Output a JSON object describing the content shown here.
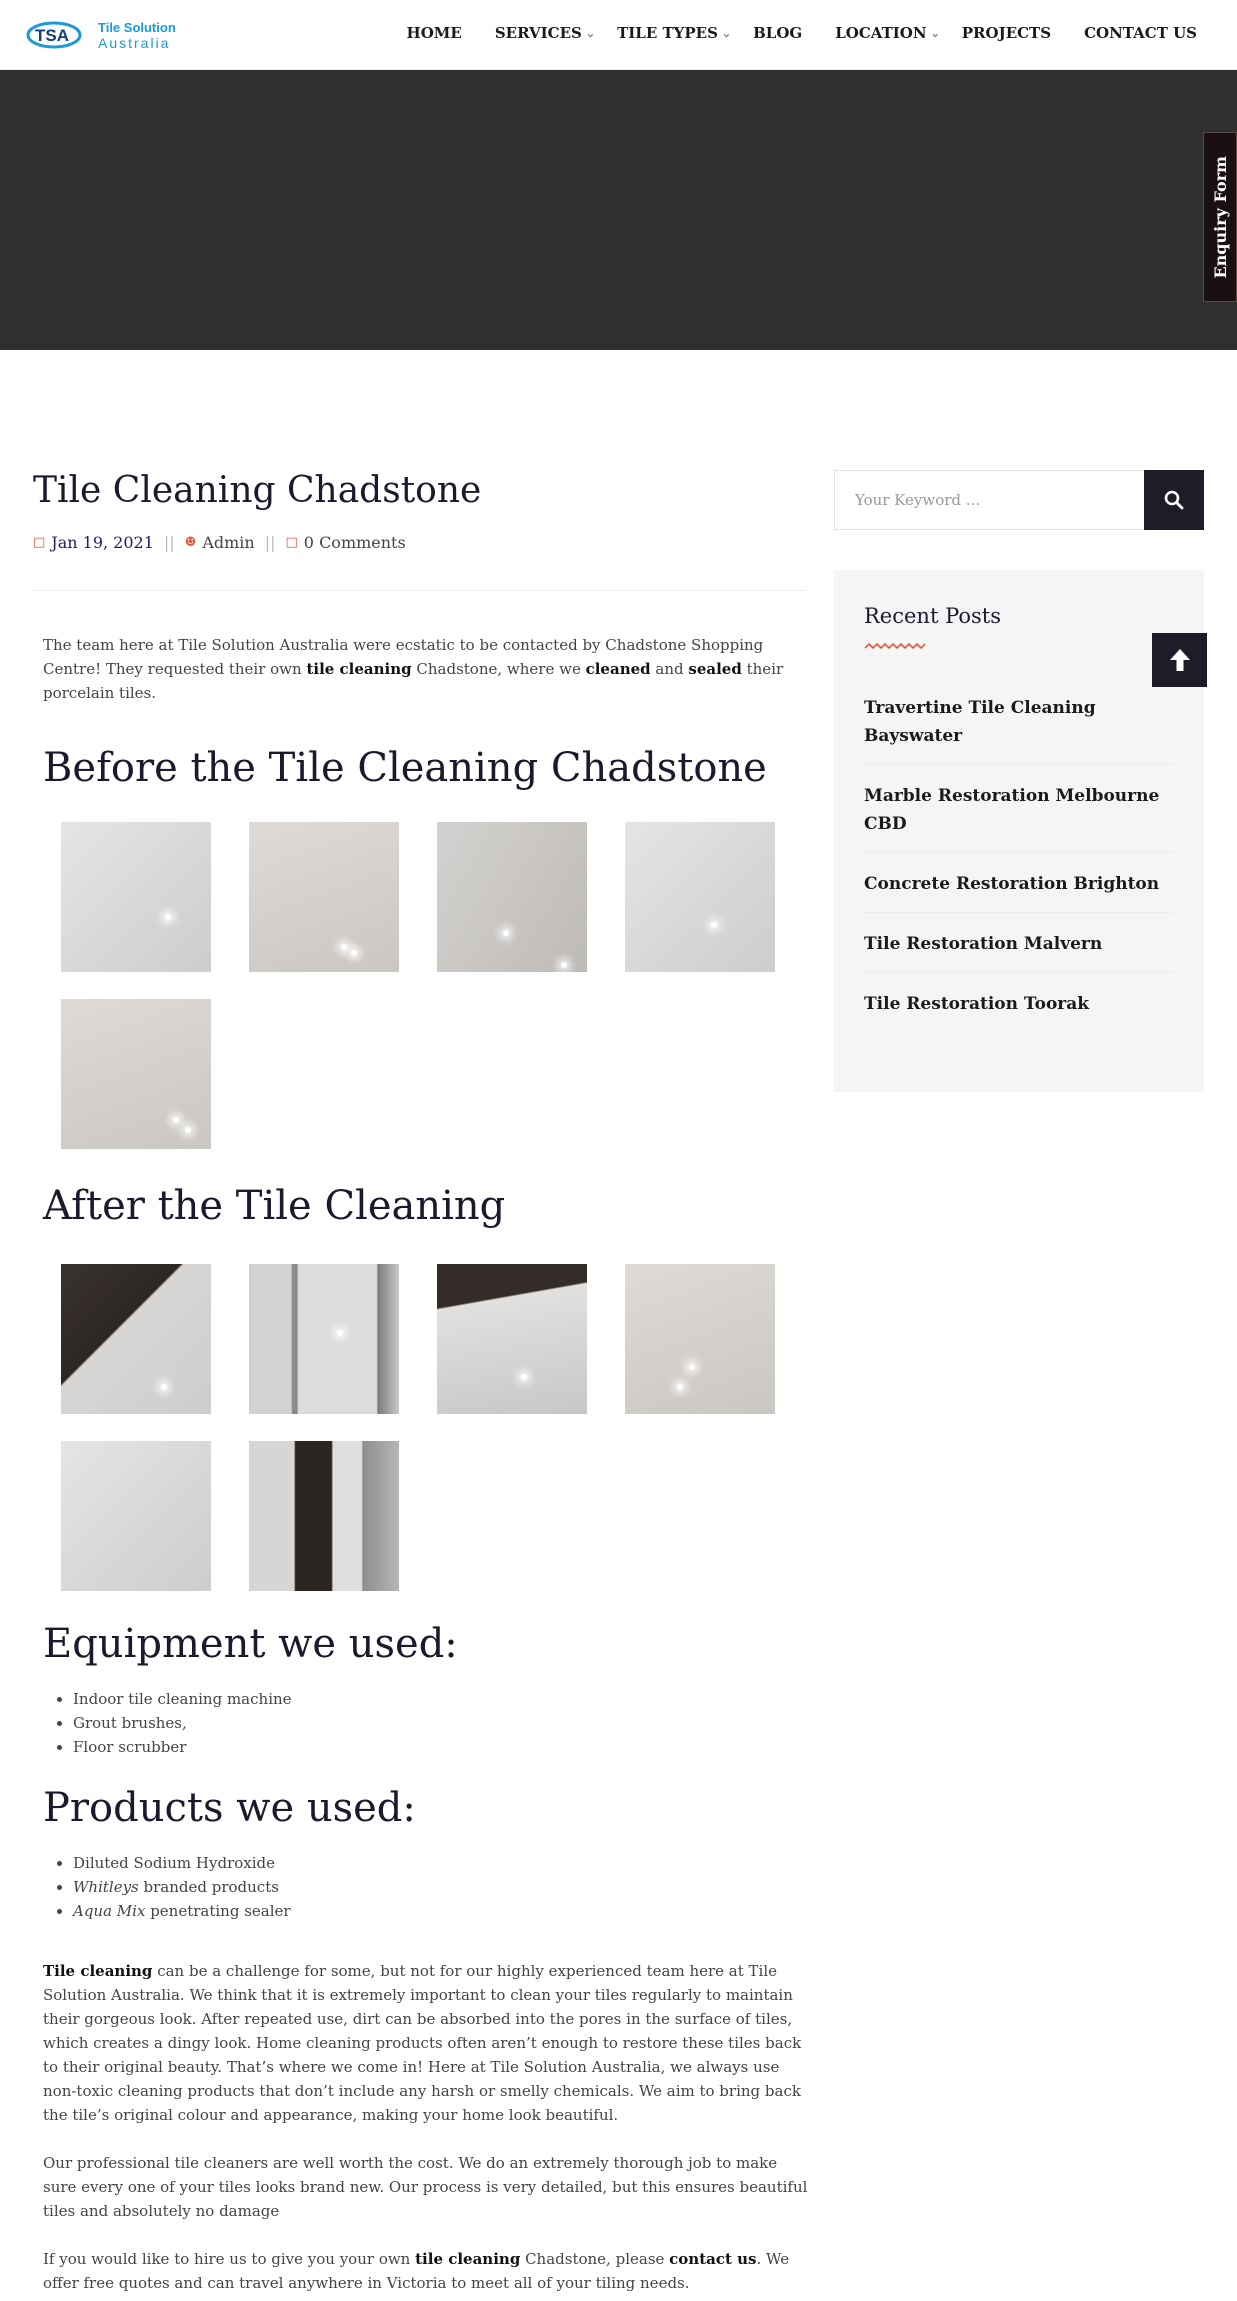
{
  "header": {
    "logo_text_top": "Tile Solution",
    "logo_text_bottom": "Australia",
    "logo_mark": "TSA",
    "nav": [
      {
        "label": "HOME",
        "dropdown": false
      },
      {
        "label": "SERVICES",
        "dropdown": true
      },
      {
        "label": "TILE TYPES",
        "dropdown": true
      },
      {
        "label": "BLOG",
        "dropdown": false
      },
      {
        "label": "LOCATION",
        "dropdown": true
      },
      {
        "label": "PROJECTS",
        "dropdown": false
      },
      {
        "label": "CONTACT US",
        "dropdown": false
      }
    ]
  },
  "enquiry_tab": "Enquiry Form",
  "post": {
    "title": "Tile Cleaning Chadstone",
    "date": "Jan 19, 2021",
    "author": "Admin",
    "comments": "0 Comments",
    "intro_1": "The team here at Tile Solution Australia were ecstatic to be contacted by Chadstone Shopping Centre! They requested their own ",
    "intro_b1": "tile cleaning",
    "intro_2": " Chadstone, where we ",
    "intro_b2": "cleaned",
    "intro_3": " and ",
    "intro_b3": "sealed",
    "intro_4": " their porcelain tiles.",
    "before_heading": "Before the Tile Cleaning Chadstone",
    "after_heading": "After the Tile Cleaning",
    "equipment_heading": "Equipment we used:",
    "equipment": [
      "Indoor tile cleaning machine",
      "Grout brushes,",
      "Floor scrubber"
    ],
    "products_heading": "Products we used:",
    "products": [
      {
        "em": "",
        "text": "Diluted Sodium Hydroxide"
      },
      {
        "em": "Whitleys",
        "text": " branded products"
      },
      {
        "em": "Aqua Mix",
        "text": " penetrating sealer"
      }
    ],
    "para1_b": "Tile cleaning",
    "para1": " can be a challenge for some, but not for our highly experienced team here at Tile Solution Australia. We think that it is extremely important to clean your tiles regularly to maintain their gorgeous look. After repeated use, dirt can be absorbed into the pores in the surface of tiles, which creates a dingy look. Home cleaning products often aren’t enough to restore these tiles back to their original beauty. That’s where we come in! Here at Tile Solution Australia, we always use non-toxic cleaning products that don’t include any harsh or smelly chemicals. We aim to bring back the tile’s original colour and appearance, making your home look beautiful.",
    "para2": "Our professional tile cleaners are well worth the cost. We do an extremely thorough job to make sure every one of your tiles looks brand new. Our process is very detailed, but this ensures beautiful tiles and absolutely no damage",
    "para3_a": "If you would like to hire us to give you your own ",
    "para3_b1": "tile cleaning",
    "para3_c": " Chadstone, please ",
    "para3_b2": "contact us",
    "para3_d": ". We offer free quotes and can travel anywhere in Victoria to meet all of your tiling needs."
  },
  "sidebar": {
    "search_placeholder": "Your Keyword ...",
    "recent_title": "Recent Posts",
    "recent_posts": [
      "Travertine Tile Cleaning Bayswater",
      "Marble Restoration Melbourne CBD",
      "Concrete Restoration Brighton",
      "Tile Restoration Malvern",
      "Tile Restoration Toorak"
    ]
  },
  "colors": {
    "accent": "#e8563f",
    "dark": "#1f1c2a",
    "hero": "#2f2f30",
    "logo_blue": "#1a9ad6"
  }
}
